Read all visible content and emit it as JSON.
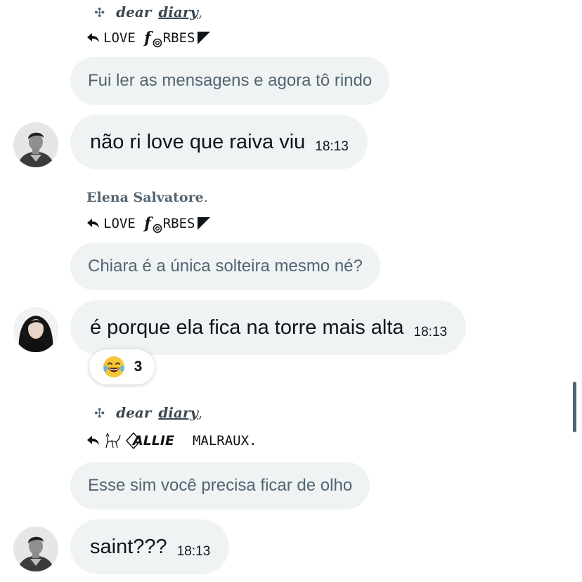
{
  "messages": [
    {
      "reply_name": {
        "cross": "✣",
        "name_a": "dear",
        "name_b": "diary",
        "punct": ","
      },
      "reply_to": {
        "prefix": "LOVE",
        "letter": "f",
        "rest": "RBES"
      },
      "quoted_text": "Fui ler as mensagens e agora tô rindo",
      "text": "não ri love que raiva viu",
      "time": "18:13",
      "avatar": "man-avatar"
    },
    {
      "reply_name": {
        "name": "Elena Salvatore",
        "punct": "."
      },
      "reply_to": {
        "prefix": "LOVE",
        "letter": "f",
        "rest": "RBES"
      },
      "quoted_text": "Chiara é a única solteira mesmo né?",
      "text": "é porque ela fica na torre mais alta",
      "time": "18:13",
      "avatar": "woman-avatar",
      "reaction": {
        "emoji": "laughing-tears-emoji",
        "count": "3"
      }
    },
    {
      "reply_name": {
        "cross": "✣",
        "name_a": "dear",
        "name_b": "diary",
        "punct": ","
      },
      "reply_to": {
        "name_a": "ALLIE",
        "name_b": "MALRAUX."
      },
      "quoted_text": "Esse sim você precisa ficar de olho",
      "text": "saint???",
      "time": "18:13",
      "avatar": "man-avatar"
    }
  ],
  "colors": {
    "bubble": "#eff3f4",
    "quoted_text": "#536471",
    "text": "#0f1419"
  }
}
